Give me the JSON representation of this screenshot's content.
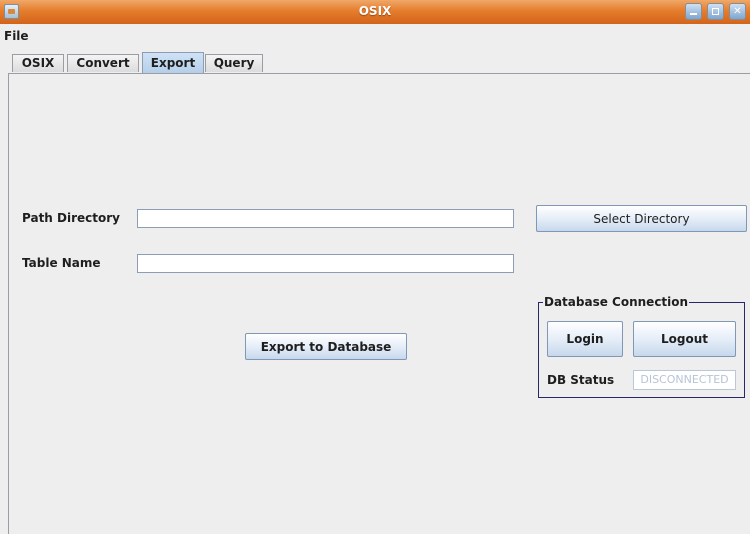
{
  "window": {
    "title": "OSIX"
  },
  "menu": {
    "file_label": "File"
  },
  "tabs": [
    {
      "label": "OSIX"
    },
    {
      "label": "Convert"
    },
    {
      "label": "Export"
    },
    {
      "label": "Query"
    }
  ],
  "active_tab": "Export",
  "form": {
    "path_label": "Path Directory",
    "path_value": "",
    "table_label": "Table Name",
    "table_value": "",
    "select_button": "Select Directory",
    "export_button": "Export to Database"
  },
  "db": {
    "group_title": "Database Connection",
    "login_button": "Login",
    "logout_button": "Logout",
    "status_label": "DB Status",
    "status_value": "DISCONNECTED"
  },
  "icons": {
    "app": "java-app-icon",
    "minimize": "minimize-icon",
    "maximize": "maximize-icon",
    "close": "close-icon"
  },
  "colors": {
    "titlebar": "#e57d2c",
    "active_tab": "#b4cee8",
    "group_border": "#27276c",
    "status_text": "#b7c4d6"
  }
}
